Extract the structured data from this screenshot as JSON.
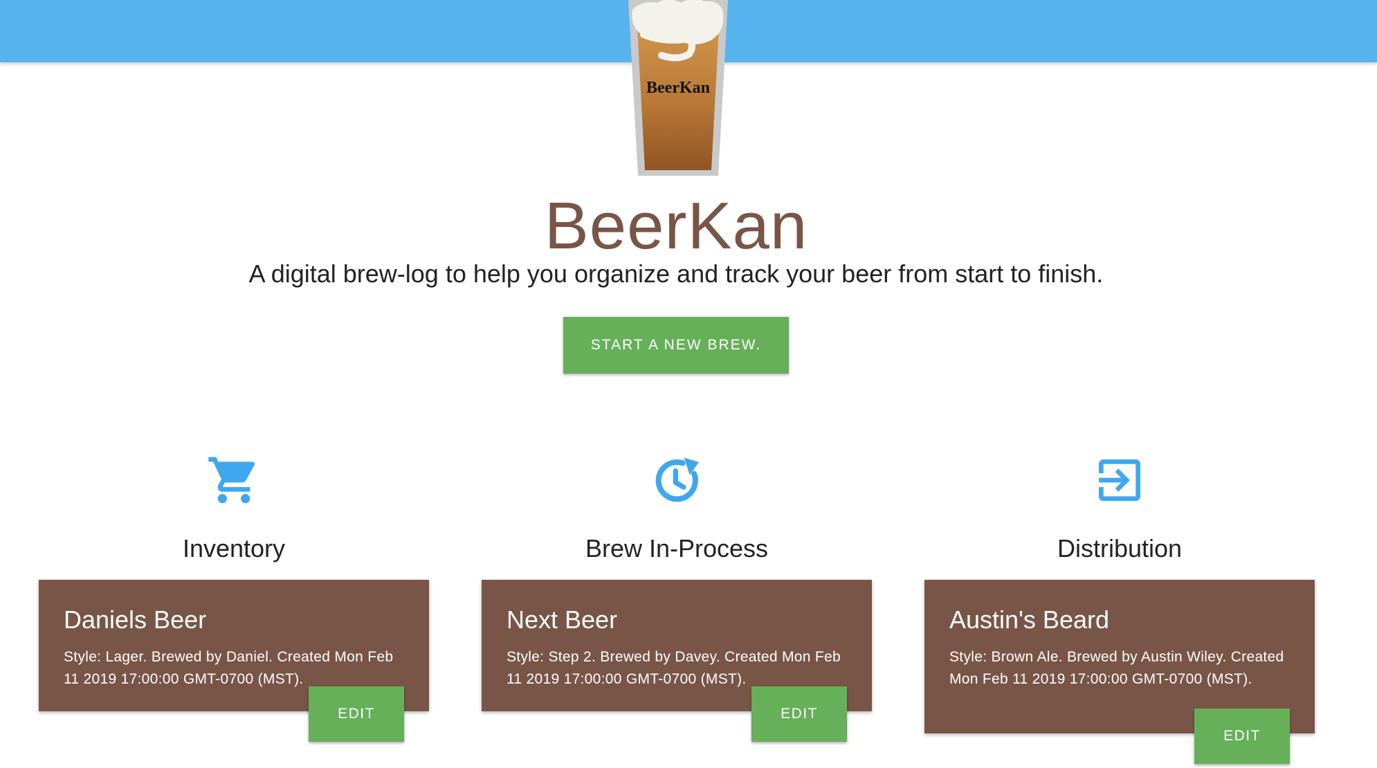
{
  "app": {
    "title": "BeerKan",
    "logo_text": "BeerKan",
    "tagline": "A digital brew-log to help you organize and track your beer from start to finish."
  },
  "actions": {
    "start_label": "START A NEW BREW."
  },
  "columns": [
    {
      "title": "Inventory",
      "icon": "cart-icon",
      "card": {
        "title": "Daniels Beer",
        "description": "Style: Lager. Brewed by Daniel. Created Mon Feb 11 2019 17:00:00 GMT-0700 (MST).",
        "edit_label": "EDIT"
      }
    },
    {
      "title": "Brew In-Process",
      "icon": "clock-refresh-icon",
      "card": {
        "title": "Next Beer",
        "description": "Style: Step 2. Brewed by Davey. Created Mon Feb 11 2019 17:00:00 GMT-0700 (MST).",
        "edit_label": "EDIT"
      }
    },
    {
      "title": "Distribution",
      "icon": "exit-to-app-icon",
      "card": {
        "title": "Austin's Beard",
        "description": "Style: Brown Ale. Brewed by Austin Wiley. Created Mon Feb 11 2019 17:00:00 GMT-0700 (MST).",
        "edit_label": "EDIT"
      }
    }
  ],
  "colors": {
    "header": "#56b3ee",
    "brand_brown": "#795548",
    "button_green": "#66b05a",
    "icon_blue": "#3fa7f0"
  }
}
